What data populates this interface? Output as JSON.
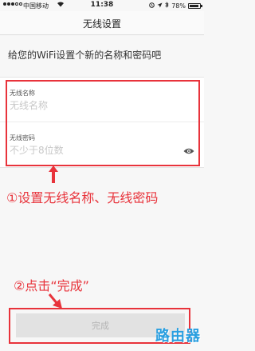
{
  "status_bar": {
    "carrier": "中国移动",
    "time": "11:38",
    "battery": "78%",
    "battery_level": 0.78
  },
  "nav": {
    "title": "无线设置"
  },
  "intro_text": "给您的WiFi设置个新的名称和密码吧",
  "form": {
    "name_label": "无线名称",
    "name_placeholder": "无线名称",
    "password_label": "无线密码",
    "password_placeholder": "不少于8位数",
    "eye_icon": "eye-icon"
  },
  "annotations": {
    "step1": "①设置无线名称、无线密码",
    "step2": "②点击“完成”",
    "color": "#e8333b"
  },
  "done_button": {
    "label": "完成"
  },
  "watermark": "路由器"
}
